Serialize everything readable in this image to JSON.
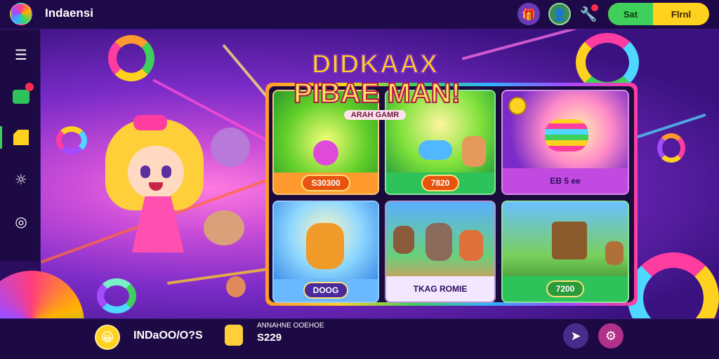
{
  "app": {
    "title": "Indaensi"
  },
  "topbar": {
    "toggle_left": "Sat",
    "toggle_right": "Flrnl"
  },
  "headline": {
    "line1": "DIDKAAX",
    "line2": "PIBAE MAN!",
    "subtitle": "ARAH GAMR"
  },
  "cards": [
    {
      "label": "S30300"
    },
    {
      "label": "7820"
    },
    {
      "label": "EB 5 ee"
    },
    {
      "label": "DOOG"
    },
    {
      "label": "TKAG ROMIE"
    },
    {
      "label": "7200"
    }
  ],
  "bottombar": {
    "username": "INDaOO/O?S",
    "caption": "ANNAHNE OOEHOE",
    "amount": "S229"
  },
  "colors": {
    "accent_green": "#3ed05a",
    "accent_yellow": "#ffd21f",
    "bar_bg": "#1d0a45"
  },
  "icons": {
    "logo": "rainbow-orb-icon",
    "gift": "gift-icon",
    "wrench": "wrench-icon",
    "menu": "menu-icon",
    "settings": "gear-icon"
  }
}
